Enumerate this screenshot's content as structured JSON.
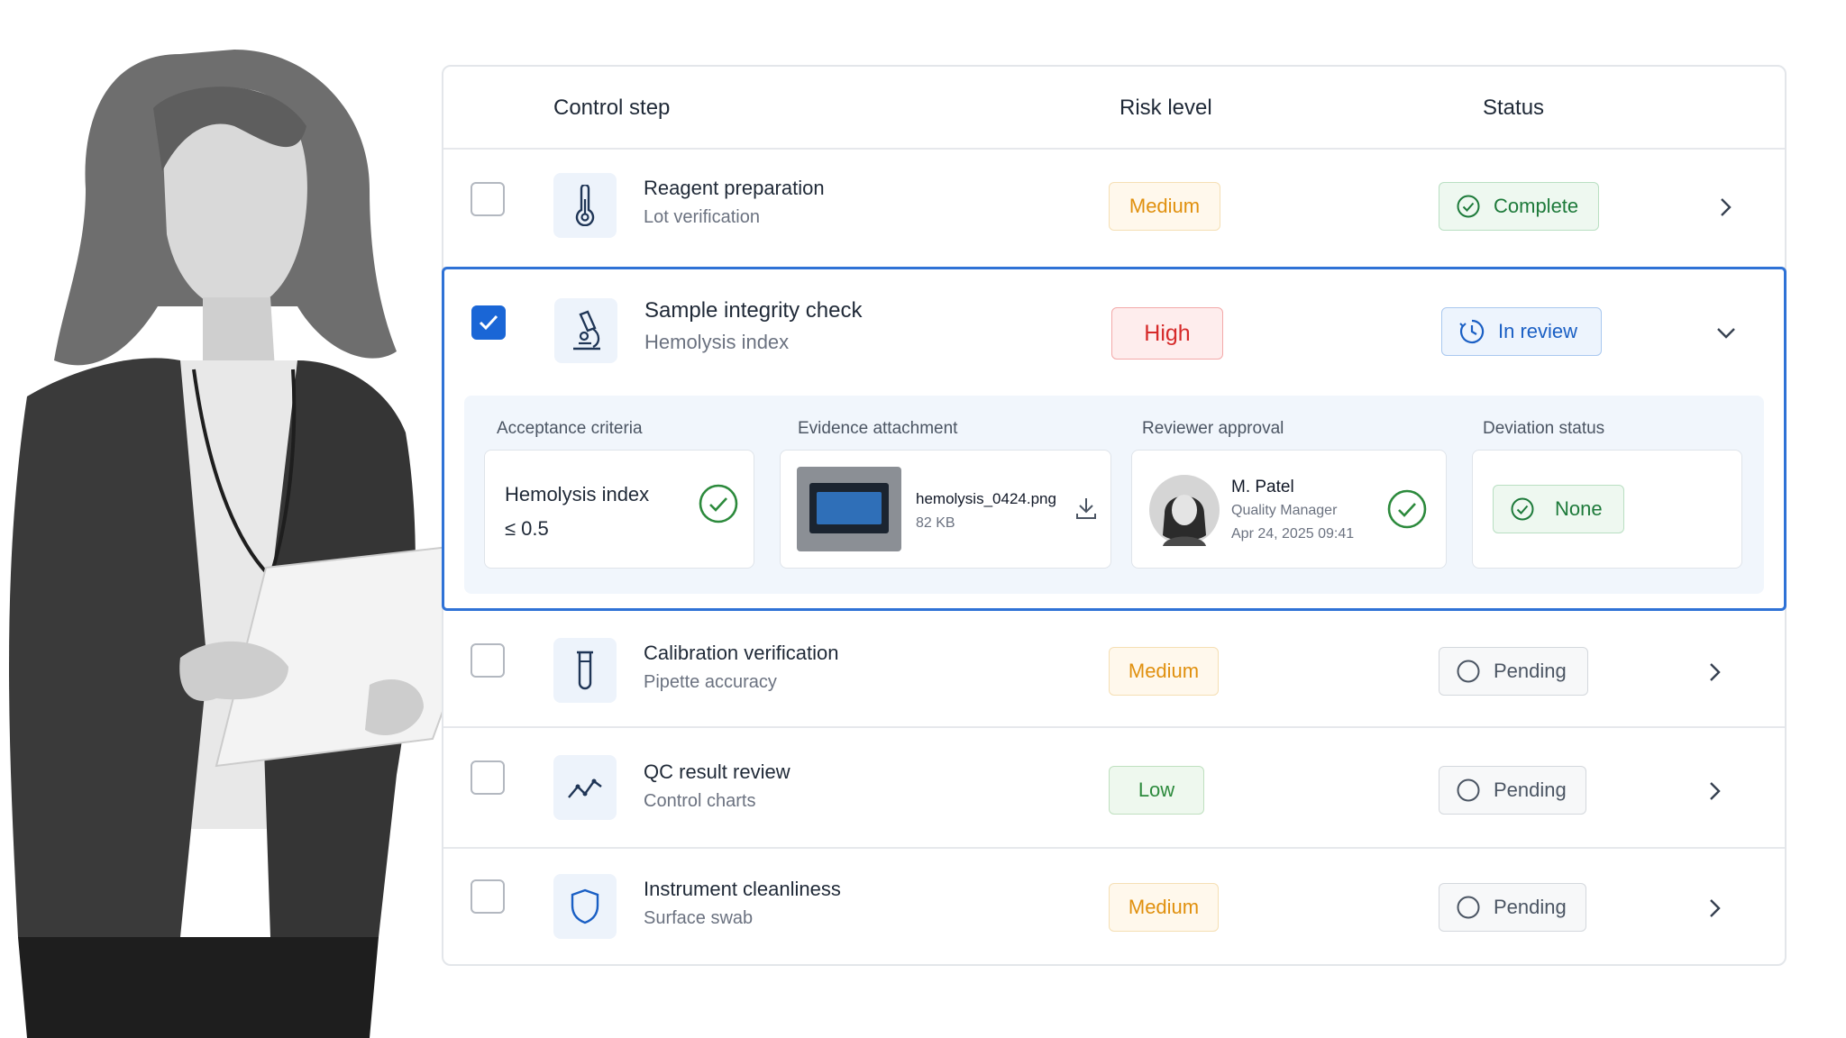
{
  "columns": {
    "step": "Control step",
    "risk": "Risk level",
    "status": "Status"
  },
  "rows": [
    {
      "title": "Reagent preparation",
      "subtitle": "Lot verification",
      "risk": "Medium",
      "status": "Complete",
      "icon": "thermometer-icon",
      "checked": false
    },
    {
      "title": "Sample integrity check",
      "subtitle": "Hemolysis index",
      "risk": "High",
      "status": "In review",
      "icon": "microscope-icon",
      "checked": true,
      "expanded": true
    },
    {
      "title": "Calibration verification",
      "subtitle": "Pipette accuracy",
      "risk": "Medium",
      "status": "Pending",
      "icon": "test-tube-icon",
      "checked": false
    },
    {
      "title": "QC result review",
      "subtitle": "Control charts",
      "risk": "Low",
      "status": "Pending",
      "icon": "line-chart-icon",
      "checked": false
    },
    {
      "title": "Instrument cleanliness",
      "subtitle": "Surface swab",
      "risk": "Medium",
      "status": "Pending",
      "icon": "shield-icon",
      "checked": false
    }
  ],
  "detail": {
    "acceptance": {
      "label": "Acceptance criteria",
      "name": "Hemolysis index",
      "value": "≤ 0.5"
    },
    "evidence": {
      "label": "Evidence attachment",
      "filename": "hemolysis_0424.png",
      "size": "82 KB"
    },
    "reviewer": {
      "label": "Reviewer approval",
      "name": "M. Patel",
      "role": "Quality Manager",
      "time": "Apr 24, 2025 09:41"
    },
    "deviation": {
      "label": "Deviation status",
      "value": "None"
    }
  },
  "colors": {
    "accent": "#1a66d6",
    "medium": "#e0900e",
    "high": "#d62a2a",
    "low": "#2c8a3c",
    "complete": "#1d7a3a"
  }
}
